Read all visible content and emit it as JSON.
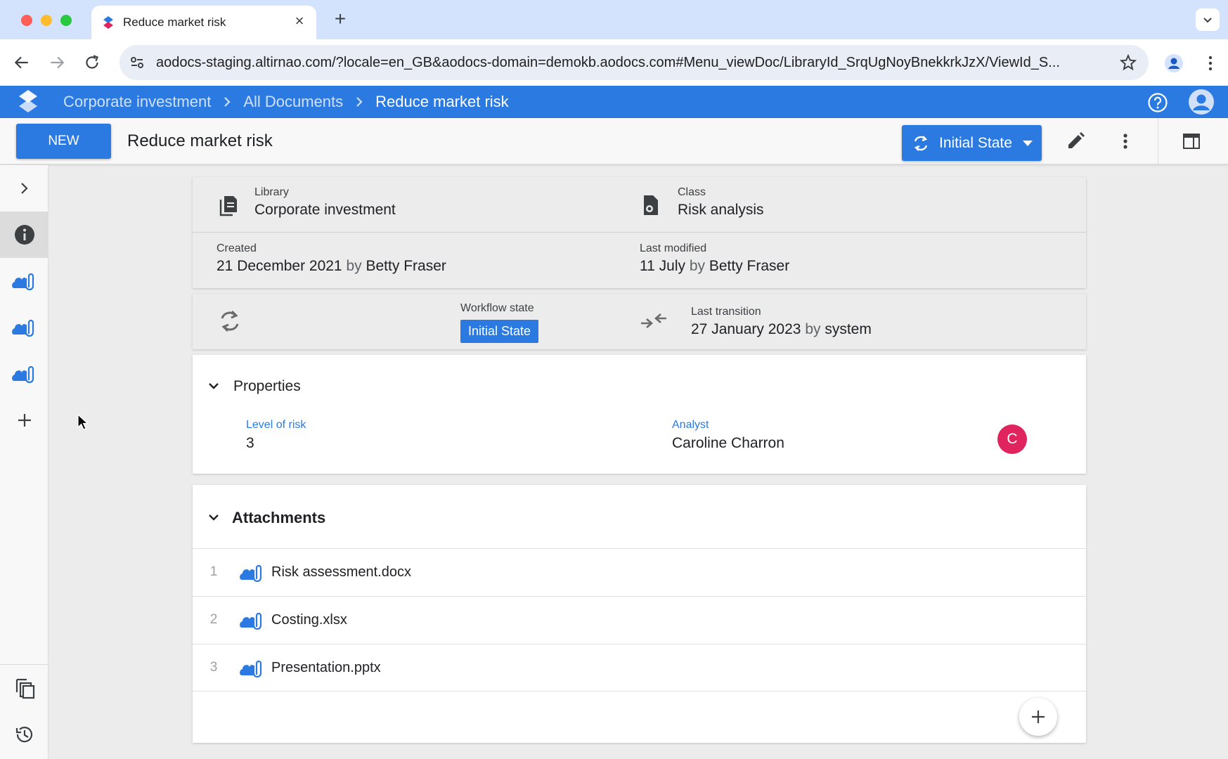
{
  "browser": {
    "tab_title": "Reduce market risk",
    "url": "aodocs-staging.altirnao.com/?locale=en_GB&aodocs-domain=demokb.aodocs.com#Menu_viewDoc/LibraryId_SrqUgNoyBnekkrkJzX/ViewId_S..."
  },
  "breadcrumb": {
    "items": [
      "Corporate investment",
      "All Documents",
      "Reduce market risk"
    ]
  },
  "toolbar": {
    "new_label": "NEW",
    "doc_title": "Reduce market risk",
    "state_button_label": "Initial State"
  },
  "header_card": {
    "library_label": "Library",
    "library_value": "Corporate investment",
    "class_label": "Class",
    "class_value": "Risk analysis",
    "created_label": "Created",
    "created_date": "21 December 2021",
    "created_by_word": "by",
    "created_by": "Betty Fraser",
    "modified_label": "Last modified",
    "modified_date": "11 July",
    "modified_by_word": "by",
    "modified_by": "Betty Fraser"
  },
  "workflow": {
    "state_label": "Workflow state",
    "state_value": "Initial State",
    "transition_label": "Last transition",
    "transition_date": "27 January 2023",
    "transition_by_word": "by",
    "transition_by": "system"
  },
  "properties": {
    "title": "Properties",
    "level_label": "Level of risk",
    "level_value": "3",
    "analyst_label": "Analyst",
    "analyst_value": "Caroline Charron",
    "analyst_avatar": "C"
  },
  "attachments": {
    "title": "Attachments",
    "items": [
      {
        "num": "1",
        "name": "Risk assessment.docx"
      },
      {
        "num": "2",
        "name": "Costing.xlsx"
      },
      {
        "num": "3",
        "name": "Presentation.pptx"
      }
    ]
  },
  "icons": {
    "rail": [
      "chevron-right-icon",
      "info-icon",
      "cloud-attachment-icon",
      "cloud-attachment-icon",
      "cloud-attachment-icon",
      "add-icon",
      "copy-icon",
      "history-icon"
    ],
    "toolbar": [
      "edit-icon",
      "more-vert-icon",
      "layout-panel-icon"
    ]
  },
  "colors": {
    "brand_blue": "#2a7ae2",
    "avatar_pink": "#e0245e",
    "tabbar": "#d3e3fd"
  }
}
